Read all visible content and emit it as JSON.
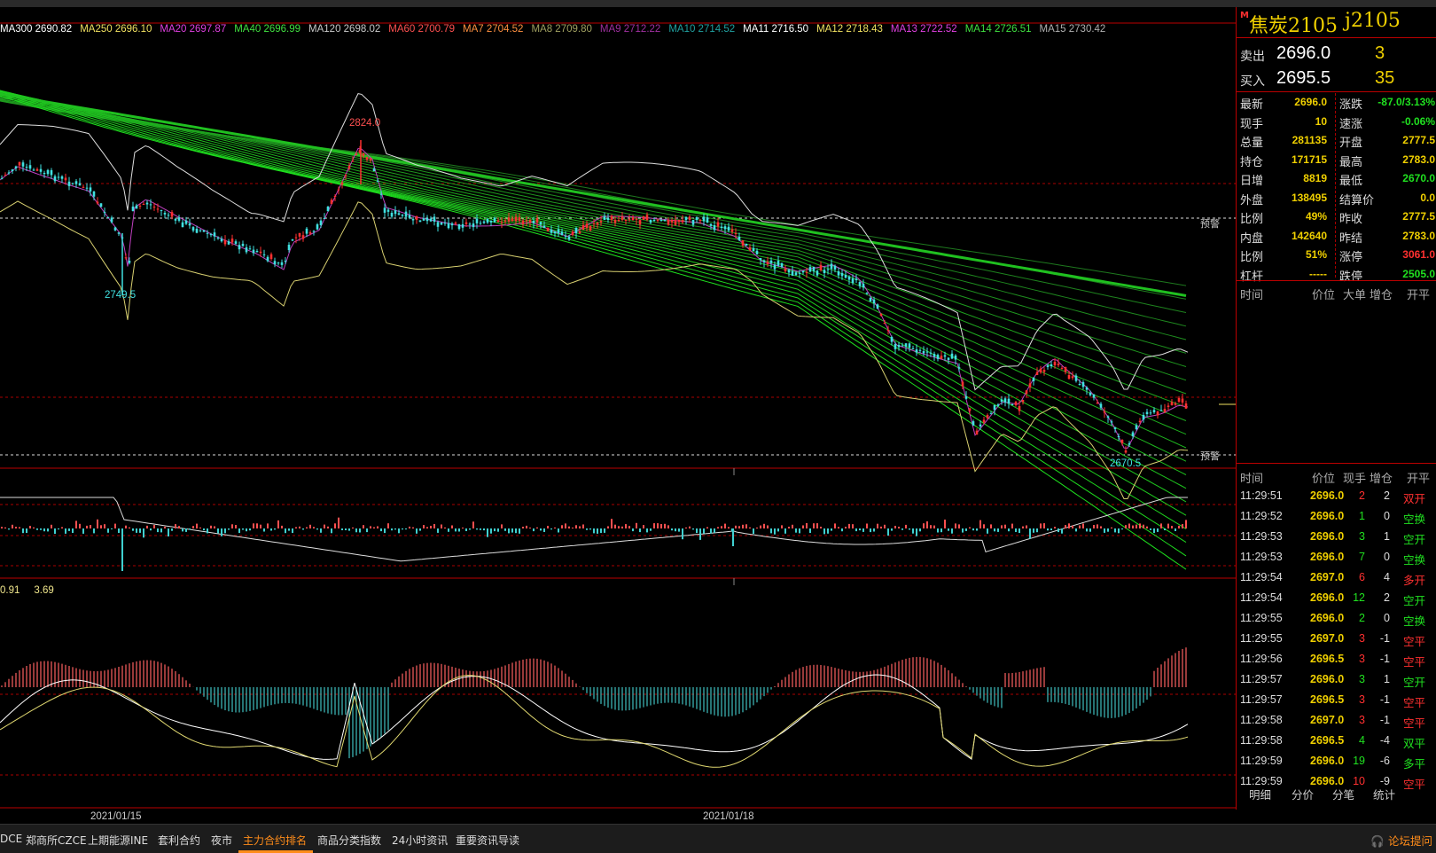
{
  "ma_legend": [
    {
      "text": "MA300 2690.82",
      "color": "#ffffff"
    },
    {
      "text": "MA250 2696.10",
      "color": "#f0e060"
    },
    {
      "text": "MA20 2697.87",
      "color": "#e040e0"
    },
    {
      "text": "MA40 2696.99",
      "color": "#40e040"
    },
    {
      "text": "MA120 2698.02",
      "color": "#c8c8c8"
    },
    {
      "text": "MA60 2700.79",
      "color": "#ff5050"
    },
    {
      "text": "MA7 2704.52",
      "color": "#ff9040"
    },
    {
      "text": "MA8 2709.80",
      "color": "#a0a060"
    },
    {
      "text": "MA9 2712.22",
      "color": "#a030a0"
    },
    {
      "text": "MA10 2714.52",
      "color": "#20a0a0"
    },
    {
      "text": "MA11 2716.50",
      "color": "#ffffff"
    },
    {
      "text": "MA12 2718.43",
      "color": "#f0e060"
    },
    {
      "text": "MA13 2722.52",
      "color": "#e040e0"
    },
    {
      "text": "MA14 2726.51",
      "color": "#40e040"
    },
    {
      "text": "MA15 2730.42",
      "color": "#b0b0b0"
    }
  ],
  "main_chart": {
    "high_label": "2824.0",
    "low_label_left": "2749.5",
    "low_label_right": "2670.5",
    "warn_label": "预警",
    "warn_label_2": "预警"
  },
  "macd_legend": {
    "v1": "0.91",
    "v2": "3.69"
  },
  "dates": [
    "2021/01/15",
    "2021/01/18"
  ],
  "panel": {
    "marker": "M",
    "name": "焦炭2105",
    "code": "j2105",
    "sell": {
      "label": "卖出",
      "price": "2696.0",
      "vol": "3"
    },
    "buy": {
      "label": "买入",
      "price": "2695.5",
      "vol": "35"
    },
    "quotes": [
      {
        "k1": "最新",
        "v1": "2696.0",
        "k2": "涨跌",
        "v2": "-87.0/3.13%",
        "c2": "#20e020"
      },
      {
        "k1": "现手",
        "v1": "10",
        "k2": "速涨",
        "v2": "-0.06%",
        "c2": "#20e020"
      },
      {
        "k1": "总量",
        "v1": "281135",
        "k2": "开盘",
        "v2": "2777.5",
        "c2": "#f0d000"
      },
      {
        "k1": "持仓",
        "v1": "171715",
        "k2": "最高",
        "v2": "2783.0",
        "c2": "#f0d000"
      },
      {
        "k1": "日增",
        "v1": "8819",
        "k2": "最低",
        "v2": "2670.0",
        "c2": "#20e020"
      },
      {
        "k1": "外盘",
        "v1": "138495",
        "k2": "结算价",
        "v2": "0.0",
        "c2": "#f0d000"
      },
      {
        "k1": "比例",
        "v1": "49%",
        "k2": "昨收",
        "v2": "2777.5",
        "c2": "#f0d000"
      },
      {
        "k1": "内盘",
        "v1": "142640",
        "k2": "昨结",
        "v2": "2783.0",
        "c2": "#f0d000"
      },
      {
        "k1": "比例",
        "v1": "51%",
        "k2": "涨停",
        "v2": "3061.0",
        "c2": "#ff3030"
      },
      {
        "k1": "杠杆",
        "v1": "-----",
        "k2": "跌停",
        "v2": "2505.0",
        "c2": "#20e020"
      }
    ],
    "big_header": {
      "time": "时间",
      "price": "价位",
      "big": "大单",
      "change": "增仓",
      "open": "开平"
    },
    "tick_header": {
      "time": "时间",
      "price": "价位",
      "vol": "现手",
      "change": "增仓",
      "open": "开平"
    },
    "ticks": [
      {
        "t": "11:29:51",
        "p": "2696.0",
        "v": "2",
        "c": "2",
        "ty": "双开",
        "vc": "#ff3030",
        "tc": "#ff3030"
      },
      {
        "t": "11:29:52",
        "p": "2696.0",
        "v": "1",
        "c": "0",
        "ty": "空换",
        "vc": "#20e020",
        "tc": "#20e020"
      },
      {
        "t": "11:29:53",
        "p": "2696.0",
        "v": "3",
        "c": "1",
        "ty": "空开",
        "vc": "#20e020",
        "tc": "#20e020"
      },
      {
        "t": "11:29:53",
        "p": "2696.0",
        "v": "7",
        "c": "0",
        "ty": "空换",
        "vc": "#20e020",
        "tc": "#20e020"
      },
      {
        "t": "11:29:54",
        "p": "2697.0",
        "v": "6",
        "c": "4",
        "ty": "多开",
        "vc": "#ff3030",
        "tc": "#ff3030"
      },
      {
        "t": "11:29:54",
        "p": "2696.0",
        "v": "12",
        "c": "2",
        "ty": "空开",
        "vc": "#20e020",
        "tc": "#20e020"
      },
      {
        "t": "11:29:55",
        "p": "2696.0",
        "v": "2",
        "c": "0",
        "ty": "空换",
        "vc": "#20e020",
        "tc": "#20e020"
      },
      {
        "t": "11:29:55",
        "p": "2697.0",
        "v": "3",
        "c": "-1",
        "ty": "空平",
        "vc": "#ff3030",
        "tc": "#ff3030"
      },
      {
        "t": "11:29:56",
        "p": "2696.5",
        "v": "3",
        "c": "-1",
        "ty": "空平",
        "vc": "#ff3030",
        "tc": "#ff3030"
      },
      {
        "t": "11:29:57",
        "p": "2696.0",
        "v": "3",
        "c": "1",
        "ty": "空开",
        "vc": "#20e020",
        "tc": "#20e020"
      },
      {
        "t": "11:29:57",
        "p": "2696.5",
        "v": "3",
        "c": "-1",
        "ty": "空平",
        "vc": "#ff3030",
        "tc": "#ff3030"
      },
      {
        "t": "11:29:58",
        "p": "2697.0",
        "v": "3",
        "c": "-1",
        "ty": "空平",
        "vc": "#ff3030",
        "tc": "#ff3030"
      },
      {
        "t": "11:29:58",
        "p": "2696.5",
        "v": "4",
        "c": "-4",
        "ty": "双平",
        "vc": "#20e020",
        "tc": "#20e020"
      },
      {
        "t": "11:29:59",
        "p": "2696.0",
        "v": "19",
        "c": "-6",
        "ty": "多平",
        "vc": "#20e020",
        "tc": "#20e020"
      },
      {
        "t": "11:29:59",
        "p": "2696.0",
        "v": "10",
        "c": "-9",
        "ty": "空平",
        "vc": "#ff3030",
        "tc": "#ff3030"
      }
    ],
    "tabs": [
      "明细",
      "分价",
      "分笔",
      "统计"
    ]
  },
  "bottom_tabs": [
    "DCE",
    "郑商所CZCE",
    "上期能源INE",
    "套利合约",
    "夜市",
    "主力合约排名",
    "商品分类指数",
    "24小时资讯",
    "重要资讯导读"
  ],
  "active_tab": "主力合约排名",
  "forum": "论坛提问",
  "colors": {
    "up": "#ff3030",
    "down": "#40e0e0",
    "accent": "#ff8c1a",
    "grid": "#b00000"
  }
}
